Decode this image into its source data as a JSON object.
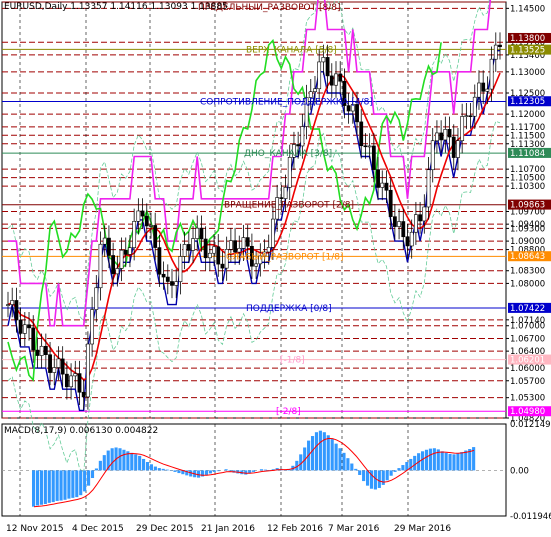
{
  "chart_data": [
    {
      "type": "candlestick",
      "symbol": "EURUSD,Daily",
      "ohlc_header": [
        "1.13357",
        "1.14116",
        "1.13093",
        "1.13885"
      ],
      "ylim": [
        1.0482,
        1.1465
      ],
      "price_axis_ticks": [
        "1.14500",
        "1.13700",
        "1.13400",
        "1.12500",
        "1.13000",
        "1.12000",
        "1.11700",
        "1.11500",
        "1.11300",
        "1.10700",
        "1.10500",
        "1.10300",
        "1.09700",
        "1.09400",
        "1.09300",
        "1.09000",
        "1.08800",
        "1.08300",
        "1.08000",
        "1.07140",
        "1.07000",
        "1.06700",
        "1.06400",
        "1.06000",
        "1.05700",
        "1.05300",
        "1.04820"
      ],
      "highlighted_price_labels": [
        {
          "text": "1.13800",
          "color": "#800000"
        },
        {
          "text": "1.13525",
          "color": "#8b8b00"
        },
        {
          "text": "1.12305",
          "color": "#0000cc"
        },
        {
          "text": "1.11084",
          "color": "#2e8b57"
        },
        {
          "text": "1.09863",
          "color": "#800000"
        },
        {
          "text": "1.08643",
          "color": "#ff8c00"
        },
        {
          "text": "1.07422",
          "color": "#0000cc"
        },
        {
          "text": "1.06201",
          "color": "#ffb6c1"
        },
        {
          "text": "1.04980",
          "color": "#ff00ff"
        }
      ],
      "murrey_labels": [
        {
          "text": "ПРЕДЕЛЬНЫЙ_РАЗВОРОТ [8/8]",
          "price": 1.1465
        },
        {
          "text": "ВЕРХ_КАНАЛА [5/8]",
          "price": 1.1353
        },
        {
          "text": "СОПРОТИВЛЕНИЕ_ПОДДЕРЖКА [4/8]",
          "price": 1.123
        },
        {
          "text": "ДНО_КАНАЛА [3/8]",
          "price": 1.1108
        },
        {
          "text": "ВРАЩЕНИЕ_РАЗВОРОТ [2/8]",
          "price": 1.0986
        },
        {
          "text": "СЛАБЫЙ_РАЗВОРОТ [1/8]",
          "price": 1.0864
        },
        {
          "text": "ПОДДЕРЖКА [0/8]",
          "price": 1.0742
        },
        {
          "text": "[-1/8]",
          "price": 1.062
        },
        {
          "text": "[-2/8]",
          "price": 1.0498
        }
      ],
      "series": [
        {
          "name": "price",
          "color": "#000000"
        },
        {
          "name": "bollinger",
          "color": "#66cc99"
        },
        {
          "name": "moving_average",
          "color": "#ee0000"
        },
        {
          "name": "channel",
          "color": "#ee22ee"
        },
        {
          "name": "chikou",
          "color": "#22dd22"
        },
        {
          "name": "kijun",
          "color": "#0000aa"
        }
      ]
    },
    {
      "type": "bar",
      "title": "MACD(8,17,9) 0.006130 0.004822",
      "yticks": [
        "0.012149",
        "0.00",
        "-0.011946"
      ],
      "ylim": [
        -0.011946,
        0.012149
      ],
      "histogram_color": "#3399ff",
      "signal_color": "#ff0000",
      "macd": [
        -0.0095,
        -0.0092,
        -0.009,
        -0.0088,
        -0.0085,
        -0.0083,
        -0.008,
        -0.0079,
        -0.0077,
        -0.0074,
        -0.0072,
        -0.007,
        -0.0065,
        -0.0055,
        -0.004,
        -0.002,
        0.0005,
        0.0025,
        0.004,
        0.0052,
        0.0058,
        0.006,
        0.0058,
        0.0054,
        0.005,
        0.0046,
        0.0042,
        0.0038,
        0.003,
        0.0022,
        0.0016,
        0.001,
        0.0006,
        0.0004,
        0.0002,
        -0.0001,
        -0.0004,
        -0.0007,
        -0.001,
        -0.0013,
        -0.0016,
        -0.0018,
        -0.0019,
        -0.0016,
        -0.0012,
        -0.0008,
        -0.0004,
        -0.0002,
        0.0,
        0.0003,
        -0.0002,
        -0.0006,
        -0.0008,
        -0.001,
        -0.0011,
        -0.0008,
        -0.0004,
        0.0,
        0.0003,
        0.0002,
        0.0001,
        0.0003,
        0.0006,
        0.0004,
        0.0002,
        0.0004,
        0.0012,
        0.0025,
        0.0042,
        0.006,
        0.0078,
        0.009,
        0.01,
        0.0104,
        0.01,
        0.0092,
        0.0082,
        0.007,
        0.0058,
        0.0046,
        0.0032,
        0.0018,
        0.0004,
        -0.0012,
        -0.0028,
        -0.004,
        -0.0048,
        -0.005,
        -0.0046,
        -0.0038,
        -0.0026,
        -0.0014,
        -0.0004,
        0.0006,
        0.0014,
        0.0022,
        0.003,
        0.0038,
        0.0045,
        0.005,
        0.0054,
        0.0057,
        0.0058,
        0.0055,
        0.005,
        0.0046,
        0.0043,
        0.0042,
        0.0044,
        0.0048,
        0.0052,
        0.0056,
        0.0061
      ]
    }
  ],
  "x_axis_labels": [
    "12 Nov 2015",
    "4 Dec 2015",
    "29 Dec 2015",
    "21 Jan 2016",
    "12 Feb 2016",
    "7 Mar 2016",
    "29 Mar 2016"
  ]
}
